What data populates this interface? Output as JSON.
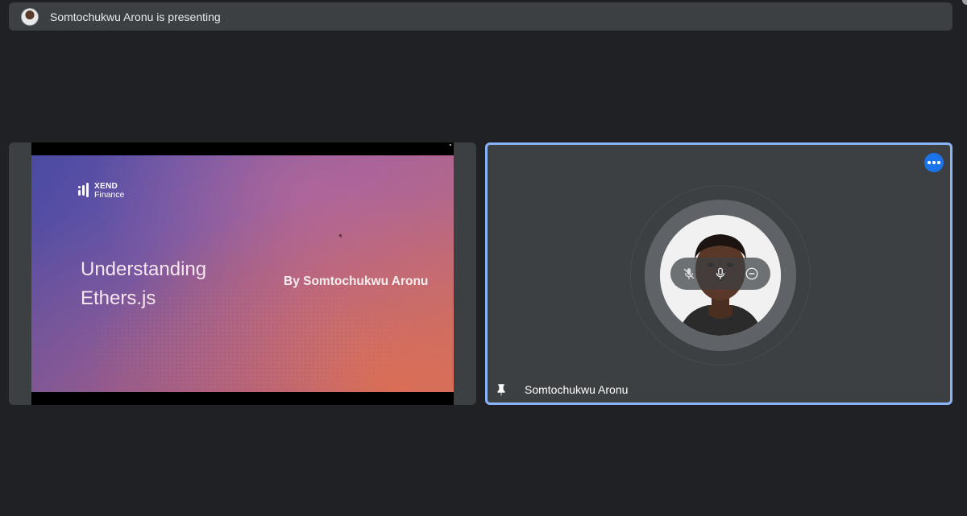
{
  "presenting_bar": {
    "text": "Somtochukwu Aronu is presenting"
  },
  "presentation": {
    "logo_line1": "XEND",
    "logo_line2": "Finance",
    "title": "Understanding Ethers.js",
    "author": "By Somtochukwu Aronu"
  },
  "participant": {
    "name": "Somtochukwu Aronu",
    "icons": [
      "more-options-icon",
      "mic-off-icon",
      "mic-icon",
      "remove-icon",
      "pin-icon"
    ]
  },
  "colors": {
    "background": "#202124",
    "tile": "#3c4043",
    "active_border": "#8ab4f8",
    "more_button": "#1a73e8"
  }
}
